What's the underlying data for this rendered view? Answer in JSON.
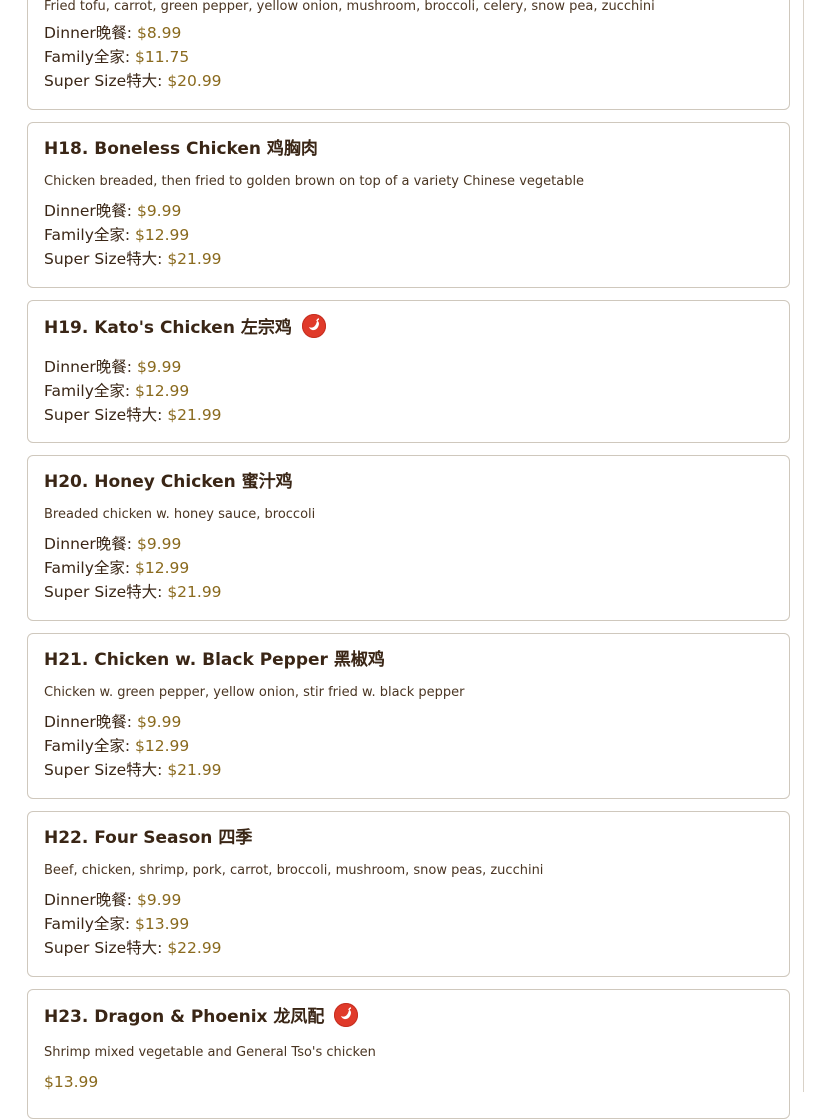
{
  "items": [
    {
      "title": "",
      "desc": "Fried tofu, carrot, green pepper, yellow onion, mushroom, broccoli, celery, snow pea, zucchini",
      "prices": [
        {
          "label": "Dinner晚餐: ",
          "price": "$8.99"
        },
        {
          "label": "Family全家: ",
          "price": "$11.75"
        },
        {
          "label": "Super Size特大: ",
          "price": "$20.99"
        }
      ]
    },
    {
      "title": "H18. Boneless Chicken 鸡胸肉",
      "desc": "Chicken breaded, then fried to golden brown on top of a variety Chinese vegetable",
      "prices": [
        {
          "label": "Dinner晚餐: ",
          "price": "$9.99"
        },
        {
          "label": "Family全家: ",
          "price": "$12.99"
        },
        {
          "label": "Super Size特大: ",
          "price": "$21.99"
        }
      ]
    },
    {
      "title": "H19. Kato's Chicken 左宗鸡",
      "spicy_icon": "chili-pepper-icon",
      "desc": "",
      "prices": [
        {
          "label": "Dinner晚餐: ",
          "price": "$9.99"
        },
        {
          "label": "Family全家: ",
          "price": "$12.99"
        },
        {
          "label": "Super Size特大: ",
          "price": "$21.99"
        }
      ]
    },
    {
      "title": "H20. Honey Chicken 蜜汁鸡",
      "desc": "Breaded chicken w. honey sauce, broccoli",
      "prices": [
        {
          "label": "Dinner晚餐: ",
          "price": "$9.99"
        },
        {
          "label": "Family全家: ",
          "price": "$12.99"
        },
        {
          "label": "Super Size特大: ",
          "price": "$21.99"
        }
      ]
    },
    {
      "title": "H21. Chicken w. Black Pepper 黑椒鸡",
      "desc": "Chicken w. green pepper, yellow onion, stir fried w. black pepper",
      "prices": [
        {
          "label": "Dinner晚餐: ",
          "price": "$9.99"
        },
        {
          "label": "Family全家: ",
          "price": "$12.99"
        },
        {
          "label": "Super Size特大: ",
          "price": "$21.99"
        }
      ]
    },
    {
      "title": "H22. Four Season 四季",
      "desc": "Beef, chicken, shrimp, pork, carrot, broccoli, mushroom, snow peas, zucchini",
      "prices": [
        {
          "label": "Dinner晚餐: ",
          "price": "$9.99"
        },
        {
          "label": "Family全家: ",
          "price": "$13.99"
        },
        {
          "label": "Super Size特大: ",
          "price": "$22.99"
        }
      ]
    },
    {
      "title": "H23. Dragon & Phoenix 龙凤配",
      "spicy_icon": "chili-pepper-icon",
      "desc": "Shrimp mixed vegetable and General Tso's chicken",
      "prices": [
        {
          "label": "",
          "price": "$13.99"
        }
      ]
    }
  ]
}
